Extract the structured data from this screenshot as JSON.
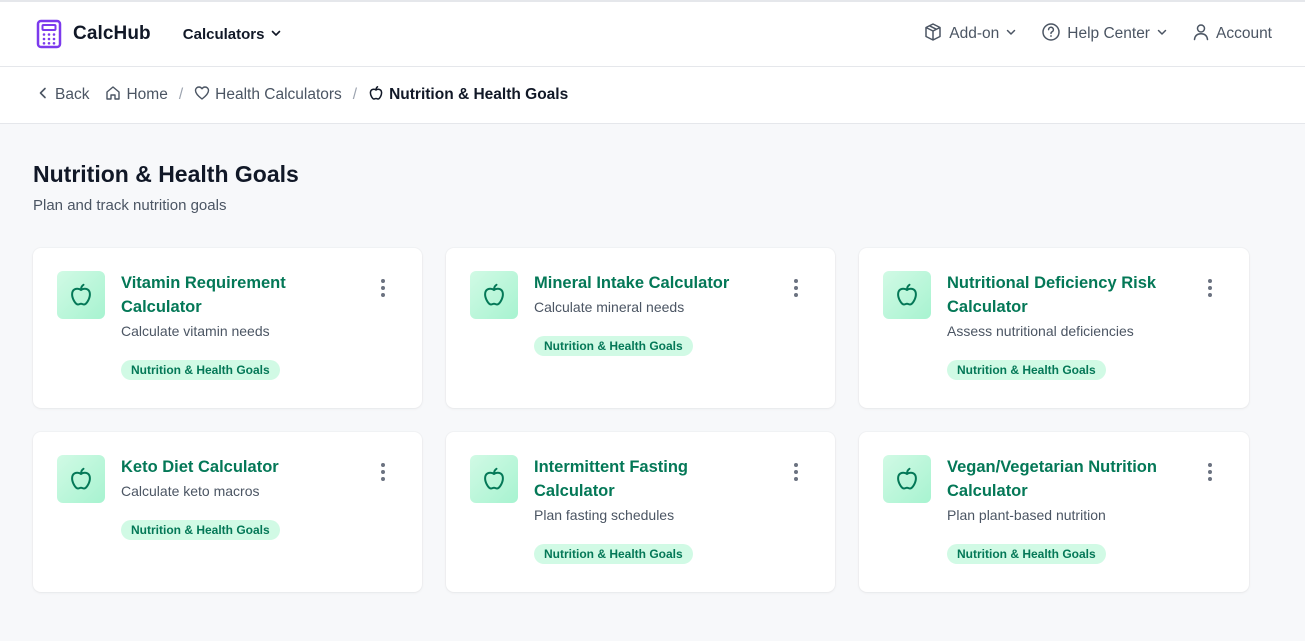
{
  "app": {
    "name": "CalcHub",
    "accent": "#7c3aed"
  },
  "nav": {
    "menu_label": "Calculators",
    "addon_label": "Add-on",
    "help_label": "Help Center",
    "account_label": "Account"
  },
  "breadcrumb": {
    "back": "Back",
    "home": "Home",
    "category": "Health Calculators",
    "current": "Nutrition & Health Goals"
  },
  "page": {
    "title": "Nutrition & Health Goals",
    "subtitle": "Plan and track nutrition goals"
  },
  "cards": [
    {
      "title": "Vitamin Requirement Calculator",
      "desc": "Calculate vitamin needs",
      "tag": "Nutrition & Health Goals",
      "icon": "apple-icon"
    },
    {
      "title": "Mineral Intake Calculator",
      "desc": "Calculate mineral needs",
      "tag": "Nutrition & Health Goals",
      "icon": "apple-icon"
    },
    {
      "title": "Nutritional Deficiency Risk Calculator",
      "desc": "Assess nutritional deficiencies",
      "tag": "Nutrition & Health Goals",
      "icon": "apple-icon"
    },
    {
      "title": "Keto Diet Calculator",
      "desc": "Calculate keto macros",
      "tag": "Nutrition & Health Goals",
      "icon": "apple-icon"
    },
    {
      "title": "Intermittent Fasting Calculator",
      "desc": "Plan fasting schedules",
      "tag": "Nutrition & Health Goals",
      "icon": "apple-icon"
    },
    {
      "title": "Vegan/Vegetarian Nutrition Calculator",
      "desc": "Plan plant-based nutrition",
      "tag": "Nutrition & Health Goals",
      "icon": "apple-icon"
    }
  ],
  "colors": {
    "card_title": "#047857",
    "tag_bg": "#d1fae5",
    "icon_bg": "#a7f3d0"
  }
}
